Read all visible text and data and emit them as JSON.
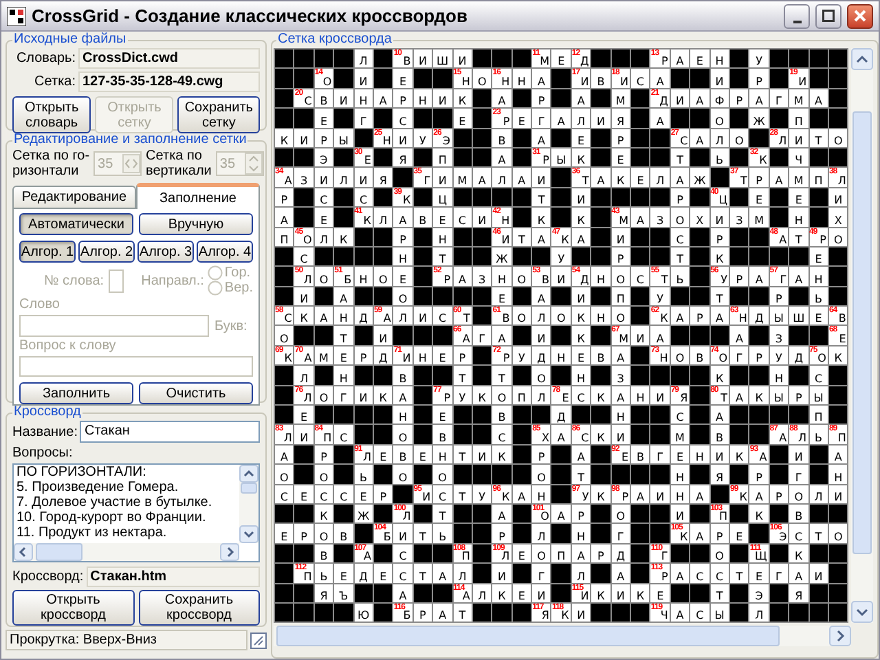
{
  "window": {
    "title": "CrossGrid - Создание классических кроссвордов"
  },
  "source_files": {
    "title": "Исходные файлы",
    "fields": [
      {
        "label": "Словарь:",
        "value": "CrossDict.cwd"
      },
      {
        "label": "Сетка:",
        "value": "127-35-35-128-49.cwg"
      }
    ],
    "buttons": [
      {
        "label": "Открыть словарь",
        "disabled": false
      },
      {
        "label": "Открыть сетку",
        "disabled": true
      },
      {
        "label": "Сохранить сетку",
        "disabled": false
      }
    ]
  },
  "editing": {
    "title": "Редактирование и заполнение сетки",
    "spinners": [
      {
        "kind": "horizontal",
        "label_lines": [
          "Сетка по го-",
          "ризонтали"
        ],
        "value": "35",
        "disabled": true
      },
      {
        "kind": "vertical",
        "label_lines": [
          "Сетка по",
          "вертикали"
        ],
        "value": "35",
        "disabled": true
      }
    ],
    "tabs": [
      {
        "label": "Редактирование",
        "selected": false
      },
      {
        "label": "Заполнение",
        "selected": true
      }
    ],
    "mode_buttons": [
      {
        "label": "Автоматически",
        "selected": true
      },
      {
        "label": "Вручную",
        "selected": false
      }
    ],
    "algorithm_buttons": [
      {
        "label": "Алгор. 1",
        "selected": true
      },
      {
        "label": "Алгор. 2",
        "selected": false
      },
      {
        "label": "Алгор. 3",
        "selected": false
      },
      {
        "label": "Алгор. 4",
        "selected": false
      }
    ],
    "word_number": {
      "label": "№ слова:",
      "disabled": true
    },
    "direction": {
      "label": "Направл.:",
      "disabled": true,
      "options": [
        {
          "label": "Гор.",
          "selected": false
        },
        {
          "label": "Вер.",
          "selected": false
        }
      ]
    },
    "word": {
      "label": "Слово",
      "disabled": true
    },
    "letters": {
      "label": "Букв:",
      "disabled": true
    },
    "question": {
      "label": "Вопрос к слову",
      "disabled": true
    },
    "buttons": [
      {
        "label": "Заполнить"
      },
      {
        "label": "Очистить"
      }
    ]
  },
  "crossword": {
    "title": "Кроссворд",
    "name": {
      "label": "Название:",
      "value": "Стакан"
    },
    "questions": {
      "label": "Вопросы:",
      "lines": [
        "ПО ГОРИЗОНТАЛИ:",
        "5. Произведение Гомера.",
        "7. Долевое участие в бутылке.",
        "10. Город-курорт во Франции.",
        "11. Продукт из нектара."
      ]
    },
    "file": {
      "label": "Кроссворд:",
      "value": "Стакан.htm"
    },
    "buttons": [
      {
        "label": "Открыть кроссворд"
      },
      {
        "label": "Сохранить кроссворд"
      }
    ]
  },
  "status_bar": "Прокрутка: Вверх-Вниз",
  "grid_panel": {
    "title": "Сетка кроссворда",
    "rows": [
      [
        null,
        null,
        null,
        null,
        "Л",
        null,
        {
          "n": "10",
          "l": "В"
        },
        "И",
        "Ш",
        "И",
        null,
        null,
        null,
        {
          "n": "11",
          "l": "М"
        },
        "Е",
        {
          "n": "12",
          "l": "Д"
        },
        null,
        null,
        null,
        {
          "n": "13",
          "l": "Р"
        },
        "А",
        "Е",
        "Н",
        null,
        "У",
        null,
        null,
        null,
        null
      ],
      [
        null,
        null,
        {
          "n": "14",
          "l": "О"
        },
        null,
        "И",
        null,
        "Е",
        null,
        null,
        {
          "n": "15",
          "l": "Н"
        },
        "О",
        {
          "n": "16",
          "l": "Н"
        },
        "Н",
        "А",
        null,
        {
          "n": "17",
          "l": "И"
        },
        "В",
        {
          "n": "18",
          "l": "И"
        },
        "С",
        "А",
        null,
        null,
        "И",
        null,
        "Р",
        null,
        {
          "n": "19",
          "l": "И"
        },
        null,
        null
      ],
      [
        null,
        {
          "n": "20",
          "l": "С"
        },
        "В",
        "И",
        "Н",
        "А",
        "Р",
        "Н",
        "И",
        "К",
        null,
        "А",
        null,
        "Р",
        null,
        "А",
        null,
        "М",
        null,
        {
          "n": "21",
          "l": "Д"
        },
        "И",
        "А",
        "Ф",
        "Р",
        "А",
        "Г",
        "М",
        "А",
        null
      ],
      [
        null,
        null,
        "Е",
        null,
        "Г",
        null,
        "С",
        null,
        null,
        "Е",
        null,
        {
          "n": "23",
          "l": "Р"
        },
        "Е",
        "Г",
        "А",
        "Л",
        "И",
        "Я",
        null,
        "А",
        null,
        null,
        "О",
        null,
        "Ж",
        null,
        "П",
        null,
        null
      ],
      [
        "К",
        "И",
        "Р",
        "Ы",
        null,
        {
          "n": "25",
          "l": "Н"
        },
        "И",
        "У",
        {
          "n": "26",
          "l": "Э"
        },
        null,
        null,
        "В",
        null,
        "А",
        null,
        "Е",
        null,
        "Р",
        null,
        null,
        {
          "n": "27",
          "l": "С"
        },
        "А",
        "Л",
        "О",
        null,
        {
          "n": "28",
          "l": "Л"
        },
        "И",
        "Т",
        "О"
      ],
      [
        null,
        null,
        "Э",
        null,
        {
          "n": "30",
          "l": "Е"
        },
        null,
        "Я",
        null,
        "П",
        null,
        null,
        "А",
        null,
        {
          "n": "31",
          "l": "Р"
        },
        "Ы",
        "К",
        null,
        "Е",
        null,
        null,
        "Т",
        null,
        "Ь",
        null,
        {
          "n": "32",
          "l": "К"
        },
        null,
        "Ч",
        null,
        null
      ],
      [
        {
          "n": "34",
          "l": "А"
        },
        "З",
        "И",
        "Л",
        "И",
        "Я",
        null,
        {
          "n": "35",
          "l": "Г"
        },
        "И",
        "М",
        "А",
        "Л",
        "А",
        "И",
        null,
        {
          "n": "36",
          "l": "Т"
        },
        "А",
        "К",
        "Е",
        "Л",
        "А",
        "Ж",
        null,
        {
          "n": "37",
          "l": "Т"
        },
        "Р",
        "А",
        "М",
        "П",
        {
          "n": "38",
          "l": "Л"
        }
      ],
      [
        "Р",
        null,
        "С",
        null,
        "С",
        null,
        {
          "n": "39",
          "l": "К"
        },
        null,
        "Ц",
        null,
        null,
        null,
        null,
        "Т",
        null,
        "И",
        null,
        null,
        null,
        null,
        "Р",
        null,
        {
          "n": "40",
          "l": "Ц"
        },
        null,
        "Е",
        null,
        "Е",
        null,
        "И"
      ],
      [
        "А",
        null,
        "Е",
        null,
        {
          "n": "41",
          "l": "К"
        },
        "Л",
        "А",
        "В",
        "Е",
        "С",
        "И",
        {
          "n": "42",
          "l": "Н"
        },
        null,
        "К",
        null,
        "К",
        null,
        {
          "n": "43",
          "l": "М"
        },
        "А",
        "З",
        "О",
        "Х",
        "И",
        "З",
        "М",
        null,
        "Н",
        null,
        "Х"
      ],
      [
        "П",
        {
          "n": "45",
          "l": "О"
        },
        "Л",
        "К",
        null,
        null,
        "Р",
        null,
        "Н",
        null,
        null,
        {
          "n": "46",
          "l": "И"
        },
        "Т",
        "А",
        {
          "n": "47",
          "l": "К"
        },
        "А",
        null,
        "И",
        null,
        null,
        "С",
        null,
        "Р",
        null,
        null,
        {
          "n": "48",
          "l": "А"
        },
        "Т",
        {
          "n": "49",
          "l": "Р"
        },
        "О"
      ],
      [
        null,
        "С",
        null,
        null,
        null,
        null,
        "Н",
        null,
        "Т",
        null,
        null,
        "Ж",
        null,
        null,
        "У",
        null,
        null,
        "Р",
        null,
        null,
        "Т",
        null,
        "К",
        null,
        null,
        null,
        null,
        "Е",
        null
      ],
      [
        null,
        {
          "n": "50",
          "l": "Л"
        },
        "О",
        {
          "n": "51",
          "l": "Б"
        },
        "Н",
        "О",
        "Е",
        null,
        {
          "n": "52",
          "l": "Р"
        },
        "А",
        "З",
        "Н",
        "О",
        {
          "n": "53",
          "l": "В"
        },
        "И",
        {
          "n": "54",
          "l": "Д"
        },
        "Н",
        "О",
        "С",
        {
          "n": "55",
          "l": "Т"
        },
        "Ь",
        null,
        {
          "n": "56",
          "l": "У"
        },
        "Р",
        "А",
        {
          "n": "57",
          "l": "Г"
        },
        "А",
        "Н",
        null
      ],
      [
        null,
        "И",
        null,
        "А",
        null,
        null,
        "О",
        null,
        null,
        null,
        null,
        "Е",
        null,
        "А",
        null,
        "И",
        null,
        "П",
        null,
        "У",
        null,
        null,
        "Т",
        null,
        null,
        "Р",
        null,
        "Ь",
        null
      ],
      [
        {
          "n": "58",
          "l": "С"
        },
        "К",
        "А",
        "Н",
        "Д",
        {
          "n": "59",
          "l": "А"
        },
        "Л",
        "И",
        "С",
        {
          "n": "60",
          "l": "Т"
        },
        null,
        {
          "n": "61",
          "l": "В"
        },
        "О",
        "Л",
        "О",
        "К",
        "Н",
        "О",
        null,
        {
          "n": "62",
          "l": "К"
        },
        "А",
        "Р",
        "А",
        {
          "n": "63",
          "l": "Н"
        },
        "Д",
        "Ы",
        "Ш",
        "Е",
        {
          "n": "64",
          "l": "В"
        }
      ],
      [
        "О",
        null,
        null,
        "Т",
        null,
        "И",
        null,
        null,
        null,
        {
          "n": "66",
          "l": "А"
        },
        "Г",
        "А",
        null,
        "И",
        null,
        "К",
        null,
        {
          "n": "67",
          "l": "М"
        },
        "И",
        "А",
        null,
        null,
        null,
        "А",
        null,
        "З",
        null,
        null,
        {
          "n": "68",
          "l": "Е"
        }
      ],
      [
        {
          "n": "69",
          "l": "К"
        },
        {
          "n": "70",
          "l": "А"
        },
        "М",
        "Е",
        "Р",
        "Д",
        {
          "n": "71",
          "l": "И"
        },
        "Н",
        "Е",
        "Р",
        null,
        {
          "n": "72",
          "l": "Р"
        },
        "У",
        "Д",
        "Н",
        "Е",
        "В",
        "А",
        null,
        {
          "n": "73",
          "l": "Н"
        },
        "О",
        "В",
        {
          "n": "74",
          "l": "О"
        },
        "Г",
        "Р",
        "У",
        "Д",
        {
          "n": "75",
          "l": "О"
        },
        "К"
      ],
      [
        null,
        "Л",
        null,
        "Н",
        null,
        null,
        "В",
        null,
        null,
        "Т",
        null,
        "Т",
        null,
        "О",
        null,
        "Н",
        null,
        "З",
        null,
        null,
        null,
        null,
        "К",
        null,
        null,
        "Н",
        null,
        "С",
        null
      ],
      [
        null,
        {
          "n": "76",
          "l": "Л"
        },
        "О",
        "Г",
        "И",
        "К",
        "А",
        null,
        {
          "n": "77",
          "l": "Р"
        },
        "У",
        "К",
        "О",
        "П",
        "Л",
        {
          "n": "78",
          "l": "Е"
        },
        "С",
        "К",
        "А",
        "Н",
        "И",
        {
          "n": "79",
          "l": "Я"
        },
        null,
        {
          "n": "80",
          "l": "Т"
        },
        "А",
        "К",
        "Ы",
        "Р",
        "Ы",
        null
      ],
      [
        null,
        "Е",
        null,
        null,
        null,
        null,
        "Н",
        null,
        "Е",
        null,
        null,
        "В",
        null,
        null,
        "Д",
        null,
        null,
        "Н",
        null,
        null,
        "С",
        null,
        "А",
        null,
        null,
        null,
        null,
        "П",
        null
      ],
      [
        {
          "n": "83",
          "l": "Л"
        },
        "И",
        {
          "n": "84",
          "l": "П"
        },
        "С",
        null,
        null,
        "О",
        null,
        "В",
        null,
        null,
        "С",
        null,
        {
          "n": "85",
          "l": "Х"
        },
        "А",
        {
          "n": "86",
          "l": "С"
        },
        "К",
        "И",
        null,
        null,
        "М",
        null,
        "В",
        null,
        null,
        {
          "n": "87",
          "l": "А"
        },
        {
          "n": "88",
          "l": "Л"
        },
        "Ь",
        {
          "n": "89",
          "l": "П"
        }
      ],
      [
        "А",
        null,
        "Р",
        null,
        {
          "n": "91",
          "l": "Л"
        },
        "Е",
        "В",
        "Е",
        "Н",
        "Т",
        "И",
        "К",
        null,
        "Р",
        null,
        "А",
        null,
        {
          "n": "92",
          "l": "Е"
        },
        "В",
        "Г",
        "Е",
        "Н",
        "И",
        "К",
        {
          "n": "93",
          "l": "А"
        },
        null,
        "И",
        null,
        "А"
      ],
      [
        "О",
        null,
        "О",
        null,
        "Ь",
        null,
        "О",
        null,
        "О",
        null,
        null,
        null,
        null,
        "О",
        null,
        "Т",
        null,
        null,
        null,
        null,
        "Н",
        null,
        "Я",
        null,
        "Р",
        null,
        "Г",
        null,
        "Н"
      ],
      [
        "С",
        "Е",
        "С",
        "С",
        "Е",
        "Р",
        null,
        {
          "n": "95",
          "l": "И"
        },
        "С",
        "Т",
        "У",
        {
          "n": "96",
          "l": "К"
        },
        "А",
        "Н",
        null,
        {
          "n": "97",
          "l": "У"
        },
        "К",
        {
          "n": "98",
          "l": "Р"
        },
        "А",
        "И",
        "Н",
        "А",
        null,
        {
          "n": "99",
          "l": "К"
        },
        "А",
        "Р",
        "О",
        "Л",
        "И"
      ],
      [
        null,
        null,
        "К",
        null,
        "Ж",
        null,
        {
          "n": "100",
          "l": "Л"
        },
        null,
        "Т",
        null,
        null,
        "А",
        null,
        {
          "n": "101",
          "l": "О"
        },
        "А",
        "Р",
        null,
        "О",
        null,
        null,
        "И",
        null,
        {
          "n": "103",
          "l": "П"
        },
        null,
        "К",
        null,
        "В",
        null,
        null
      ],
      [
        "Е",
        "Р",
        "О",
        "В",
        null,
        {
          "n": "104",
          "l": "Б"
        },
        "И",
        "Т",
        "Ь",
        null,
        null,
        "Р",
        null,
        "Л",
        null,
        "Н",
        null,
        "Г",
        null,
        null,
        {
          "n": "105",
          "l": "К"
        },
        "А",
        "Р",
        "Е",
        null,
        {
          "n": "106",
          "l": "Э"
        },
        "С",
        "Т",
        "О"
      ],
      [
        null,
        null,
        "В",
        null,
        {
          "n": "107",
          "l": "А"
        },
        null,
        "С",
        null,
        null,
        {
          "n": "108",
          "l": "П"
        },
        null,
        {
          "n": "109",
          "l": "Л"
        },
        "Е",
        "О",
        "П",
        "А",
        "Р",
        "Д",
        null,
        {
          "n": "110",
          "l": "Г"
        },
        null,
        null,
        "О",
        null,
        {
          "n": "111",
          "l": "Щ"
        },
        null,
        "К",
        null,
        null
      ],
      [
        null,
        {
          "n": "112",
          "l": "П"
        },
        "Ь",
        "Е",
        "Д",
        "Е",
        "С",
        "Т",
        "А",
        "Л",
        null,
        "И",
        null,
        "Г",
        null,
        "Л",
        null,
        "А",
        null,
        {
          "n": "113",
          "l": "Р"
        },
        "А",
        "С",
        "С",
        "Т",
        "Е",
        "Г",
        "А",
        "И",
        null
      ],
      [
        null,
        null,
        "Я",
        "Ъ",
        null,
        null,
        "А",
        null,
        null,
        {
          "n": "114",
          "l": "А"
        },
        "Л",
        "К",
        "Е",
        "И",
        null,
        {
          "n": "115",
          "l": "И"
        },
        "К",
        "И",
        "К",
        "Е",
        null,
        null,
        "Т",
        null,
        "Э",
        null,
        "Я",
        null,
        null
      ],
      [
        null,
        null,
        null,
        null,
        "Ю",
        null,
        {
          "n": "116",
          "l": "Б"
        },
        "Р",
        "А",
        "Т",
        null,
        null,
        null,
        {
          "n": "117",
          "l": "Я"
        },
        {
          "n": "118",
          "l": "К"
        },
        "И",
        null,
        null,
        null,
        {
          "n": "119",
          "l": "Ч"
        },
        "А",
        "С",
        "Ы",
        null,
        "Л",
        null,
        null,
        null,
        null
      ]
    ]
  }
}
